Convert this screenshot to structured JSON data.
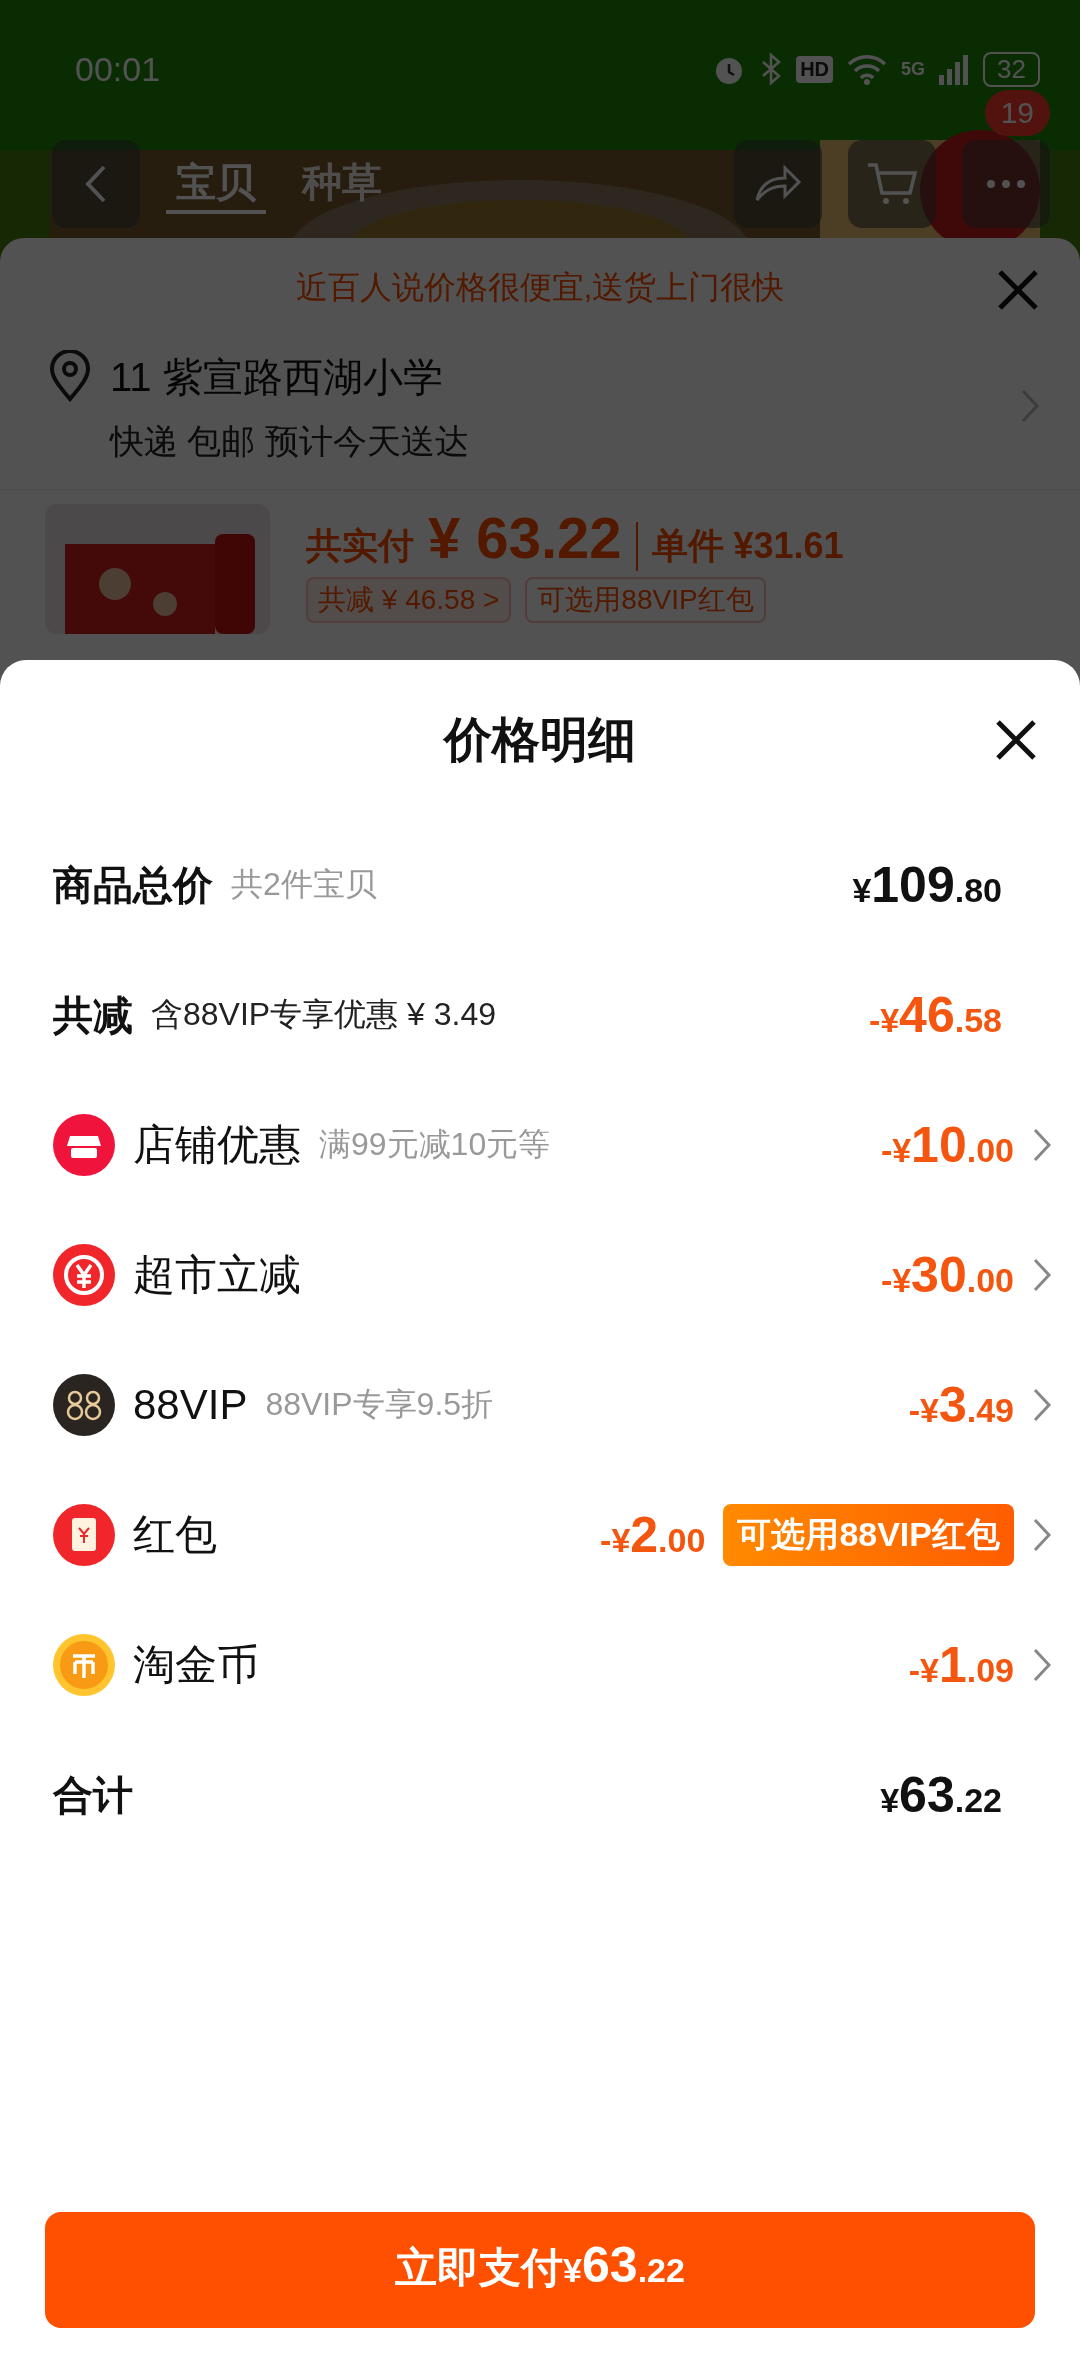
{
  "status_bar": {
    "time": "00:01",
    "hd": "HD",
    "network": "5G",
    "battery": "32"
  },
  "header": {
    "tabs": [
      {
        "label": "宝贝",
        "selected": true
      },
      {
        "label": "种草",
        "selected": false
      }
    ],
    "cart_badge": "19"
  },
  "order_panel": {
    "notice": "近百人说价格很便宜,送货上门很快",
    "address": "11 紫宣路西湖小学",
    "delivery": "快递 包邮 预计今天送达",
    "product": {
      "paid_label": "共实付",
      "paid_amount": "¥ 63.22",
      "unit_price": "单件 ¥31.61",
      "discount_chip": "共减 ¥ 46.58 >",
      "vip_chip": "可选用88VIP红包"
    }
  },
  "sheet": {
    "title": "价格明细",
    "rows": [
      {
        "kind": "summary",
        "label": "商品总价",
        "note": "共2件宝贝",
        "amount": "¥109.80"
      },
      {
        "kind": "discount",
        "label": "共减",
        "note": "含88VIP专享优惠 ¥ 3.49",
        "amount": "-¥46.58"
      },
      {
        "kind": "store",
        "label": "店铺优惠",
        "note": "满99元减10元等",
        "amount": "-¥10.00"
      },
      {
        "kind": "instant",
        "label": "超市立减",
        "amount": "-¥30.00"
      },
      {
        "kind": "vip",
        "label": "88VIP",
        "note": "88VIP专享9.5折",
        "amount": "-¥3.49"
      },
      {
        "kind": "packet",
        "label": "红包",
        "amount": "-¥2.00",
        "tag": "可选用88VIP红包"
      },
      {
        "kind": "coin",
        "label": "淘金币",
        "amount": "-¥1.09"
      },
      {
        "kind": "total",
        "label": "合计",
        "amount": "¥63.22"
      }
    ]
  },
  "pay_button": {
    "label": "立即支付",
    "amount": "¥63.22"
  }
}
